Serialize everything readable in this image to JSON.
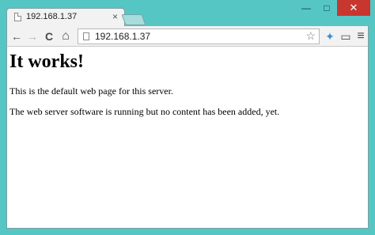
{
  "tab": {
    "title": "192.168.1.37",
    "close": "×"
  },
  "window_controls": {
    "minimize": "—",
    "maximize": "□",
    "close": "✕"
  },
  "toolbar": {
    "back": "←",
    "forward": "→",
    "reload": "C",
    "home": "⌂",
    "url": "192.168.1.37",
    "bookmark": "☆",
    "extension": "✦",
    "cast": "▭",
    "menu": "≡"
  },
  "page": {
    "heading": "It works!",
    "paragraph1": "This is the default web page for this server.",
    "paragraph2": "The web server software is running but no content has been added, yet."
  }
}
